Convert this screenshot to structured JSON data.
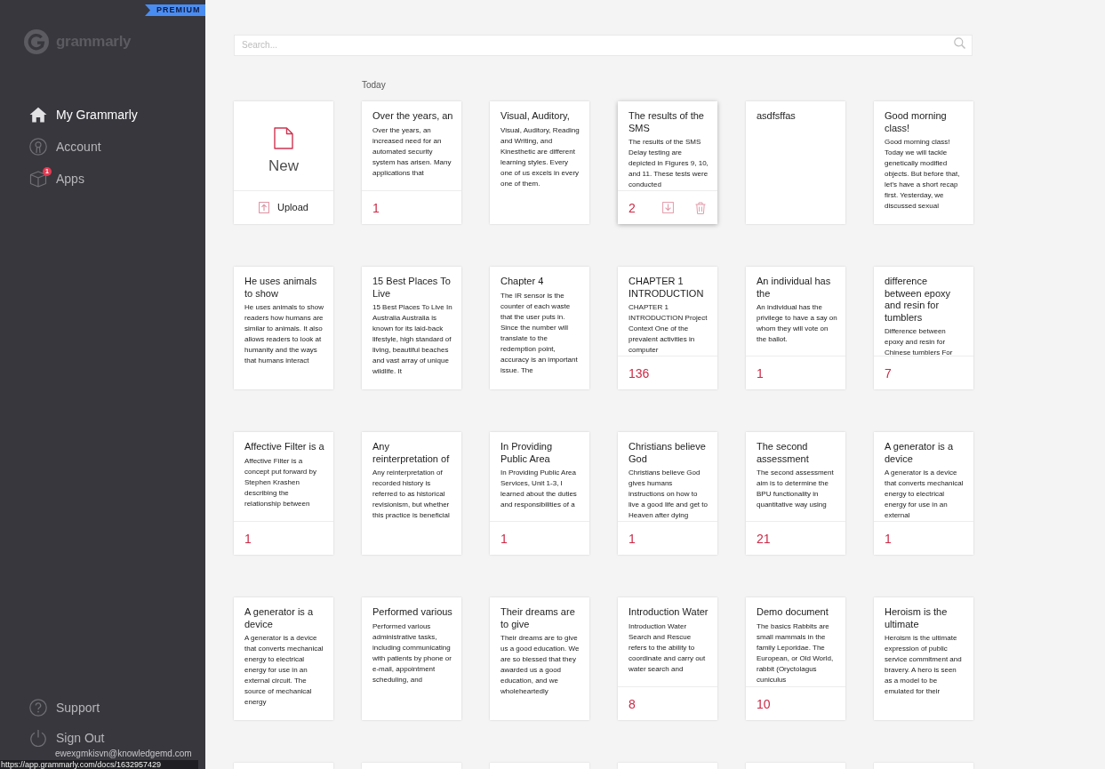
{
  "sidebar": {
    "plan_badge": "PREMIUM",
    "logo_text": "grammarly",
    "nav": [
      {
        "label": "My Grammarly",
        "selected": true
      },
      {
        "label": "Account",
        "selected": false
      },
      {
        "label": "Apps",
        "selected": false,
        "badge": "1"
      }
    ],
    "bottom_nav": [
      {
        "label": "Support"
      },
      {
        "label": "Sign Out"
      }
    ],
    "account_email": "ewexgmkisvn@knowledgemd.com"
  },
  "search": {
    "placeholder": "Search..."
  },
  "section_label": "Today",
  "new_card": {
    "label": "New",
    "upload_label": "Upload"
  },
  "documents": [
    {
      "kind": "document",
      "title": "Over the years, an",
      "excerpt": "Over the years, an increased need for an automated security system has arisen. Many applications that",
      "alerts": "1",
      "hovered": false
    },
    {
      "kind": "document",
      "title": "Visual, Auditory,",
      "excerpt": "Visual, Auditory, Reading and Writing, and Kinesthetic are different learning styles. Every one of us excels in every one of them.",
      "hovered": false
    },
    {
      "kind": "document",
      "title": "The results of the SMS",
      "excerpt": "The results of the SMS Delay testing are depicted in Figures 9, 10, and 11. These tests were conducted",
      "alerts": "2",
      "hovered": true
    },
    {
      "kind": "document",
      "title": "asdfsffas",
      "hovered": false
    },
    {
      "kind": "document",
      "title": "Good morning class!",
      "excerpt": "Good morning class! Today we will tackle genetically modified objects. But before that, let's have a short recap first. Yesterday, we discussed sexual",
      "hovered": false
    },
    {
      "kind": "document",
      "title": "He uses animals to show",
      "excerpt": "He uses animals to show readers how humans are similar to animals. It also allows readers to look at humanity and the ways that humans interact",
      "hovered": false
    },
    {
      "kind": "document",
      "title": "15 Best Places To Live",
      "excerpt": "15 Best Places To Live In Australia Australia is known for its laid-back lifestyle, high standard of living, beautiful beaches and vast array of unique wildlife. It",
      "hovered": false
    },
    {
      "kind": "document",
      "title": "Chapter 4",
      "excerpt": "The IR sensor is the counter of each waste that the user puts in. Since the number will translate to the redemption point, accuracy is an important issue. The",
      "hovered": false
    },
    {
      "kind": "document",
      "title": "CHAPTER 1 INTRODUCTION",
      "excerpt": "CHAPTER 1 INTRODUCTION Project Context One of the prevalent activities in computer",
      "alerts": "136",
      "hovered": false
    },
    {
      "kind": "document",
      "title": "An individual has the",
      "excerpt": "An individual has the privilege to have a say on whom they will vote on the ballot.",
      "alerts": "1",
      "hovered": false
    },
    {
      "kind": "document",
      "title": "difference between epoxy and resin for tumblers",
      "excerpt": "Difference between epoxy and resin for Chinese tumblers For",
      "alerts": "7",
      "hovered": false
    },
    {
      "kind": "document",
      "title": "Affective Filter is a",
      "excerpt": "Affective Filter is a concept put forward by Stephen Krashen describing the relationship between",
      "alerts": "1",
      "hovered": false
    },
    {
      "kind": "document",
      "title": "Any reinterpretation of",
      "excerpt": "Any reinterpretation of recorded history is referred to as historical revisionism, but whether this practice is beneficial",
      "hovered": false
    },
    {
      "kind": "document",
      "title": "In Providing Public Area",
      "excerpt": "In Providing Public Area Services, Unit 1-3, I learned about the duties and responsibilities of a",
      "alerts": "1",
      "hovered": false
    },
    {
      "kind": "document",
      "title": "Christians believe God",
      "excerpt": "Christians believe God gives humans instructions on how to live a good life and get to Heaven after dying",
      "alerts": "1",
      "hovered": false
    },
    {
      "kind": "document",
      "title": "The second assessment",
      "excerpt": "The second assessment aim is to determine the BPU functionality in quantitative way using",
      "alerts": "21",
      "hovered": false
    },
    {
      "kind": "document",
      "title": "A generator is a device",
      "excerpt": "A generator is a device that converts mechanical energy to electrical energy for use in an external",
      "alerts": "1",
      "hovered": false
    },
    {
      "kind": "document",
      "title": "A generator is a device",
      "excerpt": "A generator is a device that converts mechanical energy to electrical energy for use in an external circuit. The source of mechanical energy",
      "hovered": false
    },
    {
      "kind": "document",
      "title": "Performed various",
      "excerpt": "Performed various administrative tasks, including communicating with patients by phone or e-mail, appointment scheduling, and",
      "hovered": false
    },
    {
      "kind": "document",
      "title": "Their dreams are to give",
      "excerpt": "Their dreams are to give us a good education. We are so blessed that they awarded us a good education, and we wholeheartedly",
      "hovered": false
    },
    {
      "kind": "document",
      "title": "Introduction Water",
      "excerpt": "Introduction Water Search and Rescue refers to the ability to coordinate and carry out water search and",
      "alerts": "8",
      "hovered": false
    },
    {
      "kind": "document",
      "title": "Demo document",
      "excerpt": "The basics Rabbits are small mammals in the family Leporidae. The European, or Old World, rabbit (Oryctolagus cuniculus",
      "alerts": "10",
      "hovered": false
    },
    {
      "kind": "document",
      "title": "Heroism is the ultimate",
      "excerpt": "Heroism is the ultimate expression of public service commitment and bravery. A hero is seen as a model to be emulated for their",
      "hovered": false
    },
    {
      "kind": "partial"
    },
    {
      "kind": "partial"
    },
    {
      "kind": "partial"
    },
    {
      "kind": "partial"
    },
    {
      "kind": "partial"
    },
    {
      "kind": "partial"
    }
  ],
  "status_bar": {
    "url": "https://app.grammarly.com/docs/1632957429"
  }
}
